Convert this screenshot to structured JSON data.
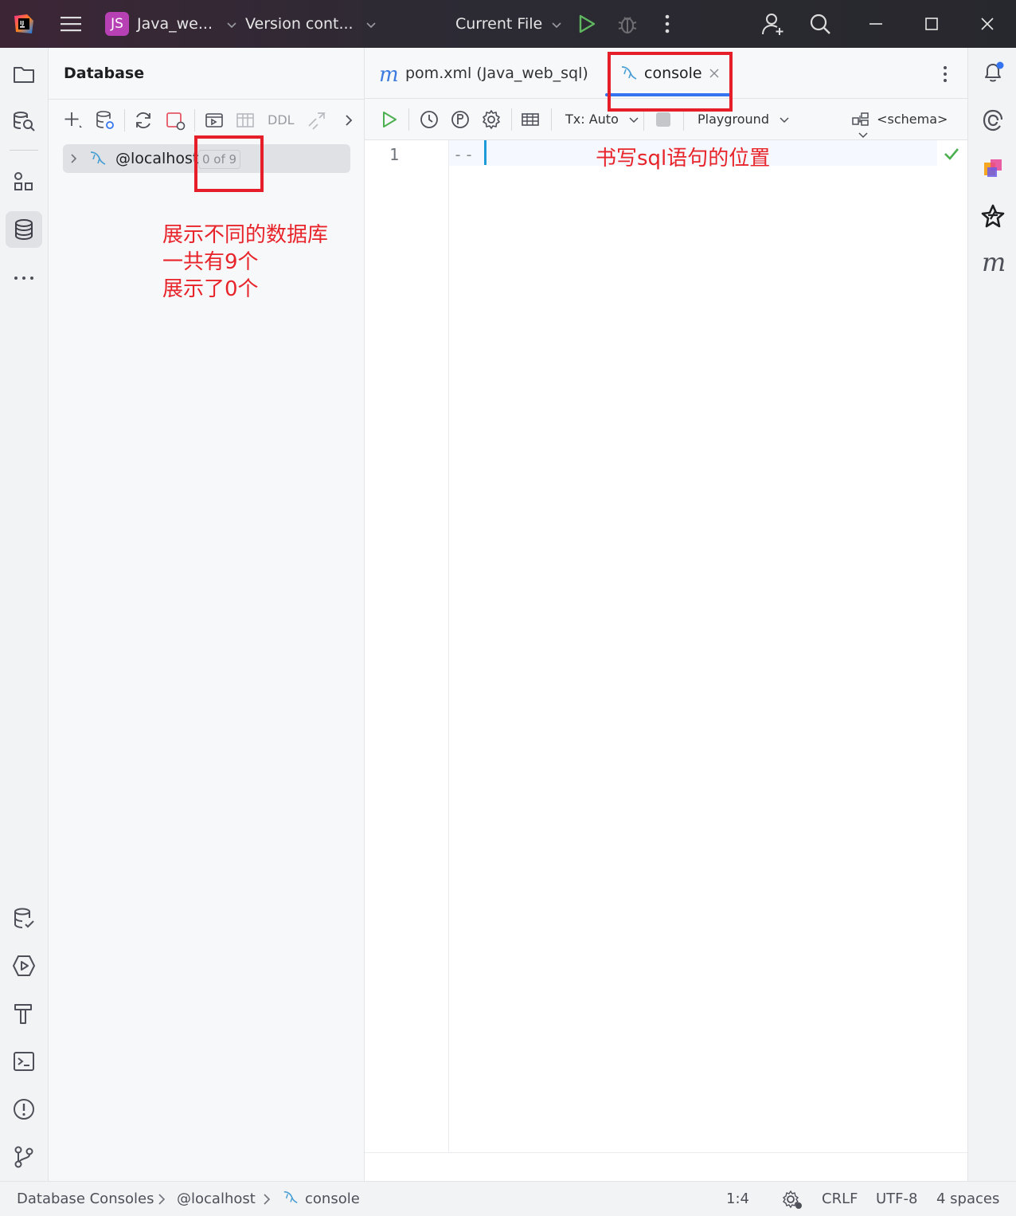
{
  "titlebar": {
    "project_badge": "JS",
    "project_name": "Java_we...",
    "vcs_label": "Version cont...",
    "run_config": "Current File"
  },
  "database_panel": {
    "title": "Database",
    "toolbar": {
      "ddl_label": "DDL"
    },
    "tree": [
      {
        "label": "@localhost",
        "count": "0 of 9"
      }
    ],
    "annotation": [
      "展示不同的数据库",
      "一共有9个",
      "展示了0个"
    ]
  },
  "editor": {
    "tabs": [
      {
        "icon": "m",
        "label": "pom.xml (Java_web_sql)",
        "active": false
      },
      {
        "label": "console",
        "active": true
      }
    ],
    "toolbar": {
      "tx_label": "Tx: Auto",
      "playground_label": "Playground",
      "schema_label": "<schema>"
    },
    "lines": [
      {
        "number": "1",
        "code": "--"
      }
    ],
    "annotation": "书写sql语句的位置"
  },
  "right_strip": {
    "m_icon": "m"
  },
  "statusbar": {
    "breadcrumb": [
      "Database Consoles",
      "@localhost",
      "console"
    ],
    "position": "1:4",
    "line_ending": "CRLF",
    "encoding": "UTF-8",
    "indent": "4 spaces"
  },
  "colors": {
    "annotation_red": "#e8242b",
    "accent_blue": "#3574f0",
    "run_green": "#4caf50",
    "badge_purple": "#b640b4"
  }
}
